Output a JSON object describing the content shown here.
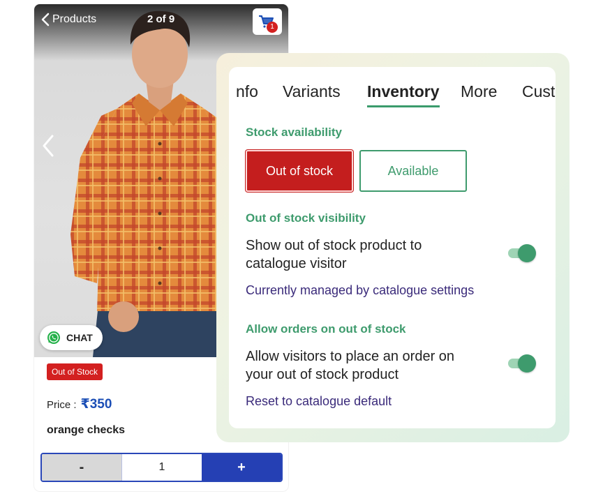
{
  "product_view": {
    "back_label": "Products",
    "image_counter": "2 of 9",
    "cart_count": "1",
    "chat_label": "CHAT",
    "stock_badge": "Out of Stock",
    "price_label": "Price :",
    "price_value": "₹350",
    "product_name": "orange checks",
    "quantity": {
      "minus_label": "-",
      "value": "1",
      "plus_label": "+"
    }
  },
  "settings_panel": {
    "tabs": [
      {
        "label": "nfo"
      },
      {
        "label": "Variants"
      },
      {
        "label": "Inventory",
        "active": true
      },
      {
        "label": "More"
      },
      {
        "label": "Cust"
      }
    ],
    "stock_availability": {
      "title": "Stock availability",
      "options": [
        "Out of stock",
        "Available"
      ],
      "selected": "Out of stock"
    },
    "out_of_stock_visibility": {
      "title": "Out of stock visibility",
      "description": "Show out of stock product to catalogue visitor",
      "toggle_on": true,
      "link": "Currently managed by catalogue settings"
    },
    "allow_orders": {
      "title": "Allow orders on out of stock",
      "description": "Allow visitors to place an order on your out of stock product",
      "toggle_on": true,
      "link": "Reset to catalogue default"
    }
  },
  "colors": {
    "accent_green": "#3e9b6d",
    "alert_red": "#c41e1e",
    "primary_blue": "#2540b4",
    "link_purple": "#3a2a7a"
  }
}
